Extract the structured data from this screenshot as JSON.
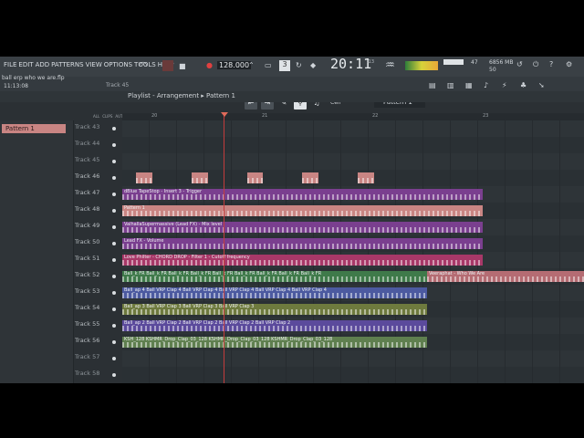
{
  "menu": [
    "FILE",
    "EDIT",
    "ADD",
    "PATTERNS",
    "VIEW",
    "OPTIONS",
    "TOOLS",
    "HELP"
  ],
  "transport": {
    "bpm": "128.000",
    "clock": "20:11",
    "clock_frac": ":13",
    "clock_sub": "M:S:CS"
  },
  "cpu": {
    "ram": "6856 MB",
    "voices": "47",
    "poly": "50",
    "cpu_num": "0"
  },
  "project": {
    "name": "ball erp who we are.flp",
    "time": "11:13:08",
    "hint_track": "Track 45"
  },
  "tool": {
    "snap": "Cell",
    "pattern": "Pattern 1"
  },
  "playlist": {
    "breadcrumb": "Playlist - Arrangement",
    "pattern": "Pattern 1"
  },
  "picker": {
    "items": [
      "Pattern 1"
    ]
  },
  "ruler": [
    "20",
    "21",
    "22",
    "23"
  ],
  "tabs": [
    "ALL",
    "CLIPS",
    "AUTO",
    "PAT"
  ],
  "tracks": [
    {
      "name": "Track 43",
      "clips": []
    },
    {
      "name": "Track 44",
      "clips": []
    },
    {
      "name": "Track 45",
      "clips": []
    },
    {
      "name": "Track 46",
      "clips": [
        {
          "label": "",
          "color": "#c98583",
          "start": 0.03,
          "len": 0.035
        },
        {
          "label": "",
          "color": "#c98583",
          "start": 0.15,
          "len": 0.035
        },
        {
          "label": "",
          "color": "#c98583",
          "start": 0.27,
          "len": 0.035
        },
        {
          "label": "",
          "color": "#c98583",
          "start": 0.39,
          "len": 0.035
        },
        {
          "label": "",
          "color": "#c98583",
          "start": 0.51,
          "len": 0.035
        }
      ]
    },
    {
      "name": "Track 47",
      "clips": [
        {
          "label": "dBlue TapeStop - Insert 3 - Trigger",
          "color": "#7a3f8f",
          "start": 0.0,
          "len": 0.78
        }
      ]
    },
    {
      "name": "Track 48",
      "clips": [
        {
          "label": "Pattern 1",
          "color": "#c98583",
          "start": 0.0,
          "len": 0.78
        }
      ]
    },
    {
      "name": "Track 49",
      "clips": [
        {
          "label": "ValhallaSupermassive (Lead FX) - Mix level",
          "color": "#7a3f8f",
          "start": 0.0,
          "len": 0.78
        }
      ]
    },
    {
      "name": "Track 50",
      "clips": [
        {
          "label": "Lead FX - Volume",
          "color": "#7a3f8f",
          "start": 0.0,
          "len": 0.78
        }
      ]
    },
    {
      "name": "Track 51",
      "clips": [
        {
          "label": "Love Philter - CHORD DROP - Filter 1 - Cutoff frequency",
          "color": "#a83868",
          "start": 0.0,
          "len": 0.78
        }
      ]
    },
    {
      "name": "Track 52",
      "clips": [
        {
          "label": "Ball_k FR  Ball_k FR  Ball_k FR  Ball_k FR  Ball_k FR  Ball_k FR  Ball_k FR  Ball_k FR  Ball_k FR",
          "color": "#3f7a4a",
          "start": 0.0,
          "len": 0.66
        },
        {
          "label": "Veeraphat - Who We Are",
          "color": "#b56c73",
          "start": 0.66,
          "len": 0.34
        }
      ]
    },
    {
      "name": "Track 53",
      "clips": [
        {
          "label": "Ball_ap 4  Ball VRP Clap 4  Ball VRP Clap 4  Ball VRP Clap 4  Ball VRP Clap 4  Ball VRP Clap 4",
          "color": "#4c5aa0",
          "start": 0.0,
          "len": 0.66
        }
      ]
    },
    {
      "name": "Track 54",
      "clips": [
        {
          "label": "Ball_ap 3  Ball VRP Clap 3  Ball VRP Clap 3  Ball VRP Clap 3",
          "color": "#6e7a3e",
          "start": 0.0,
          "len": 0.66
        }
      ]
    },
    {
      "name": "Track 55",
      "clips": [
        {
          "label": "Ball_ap 2  Ball VRP Clap 2  Ball VRP Clap 2  Ball VRP Clap 2  Ball VRP Clap 2",
          "color": "#5b4a9c",
          "start": 0.0,
          "len": 0.66
        }
      ]
    },
    {
      "name": "Track 56",
      "clips": [
        {
          "label": "KSH_128  KSHMR_Drop_Clap_03_128  KSHMR_Drop_Clap_03_128  KSHMR_Drop_Clap_03_128",
          "color": "#5f7f4f",
          "start": 0.0,
          "len": 0.66
        }
      ]
    },
    {
      "name": "Track 57",
      "clips": []
    },
    {
      "name": "Track 58",
      "clips": []
    }
  ]
}
